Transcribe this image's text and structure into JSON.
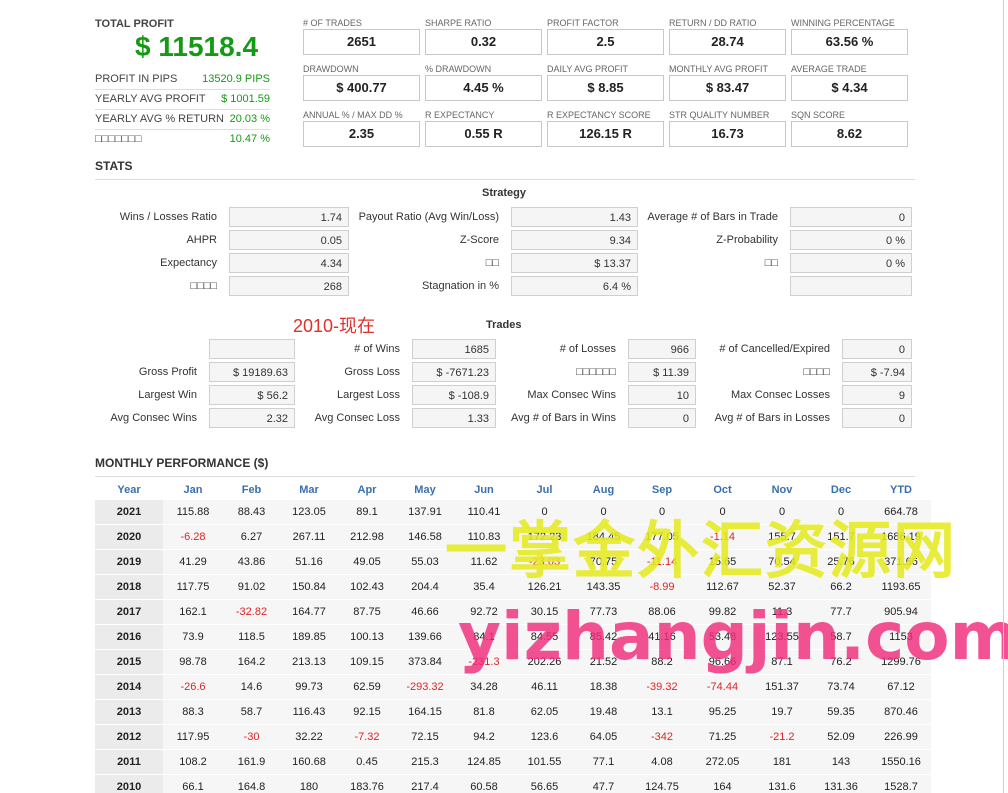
{
  "summary": {
    "total_profit_label": "TOTAL PROFIT",
    "total_profit_value": "$ 11518.4",
    "rows": [
      {
        "label": "PROFIT IN PIPS",
        "value": "13520.9 PIPS"
      },
      {
        "label": "YEARLY AVG PROFIT",
        "value": "$ 1001.59"
      },
      {
        "label": "YEARLY AVG % RETURN",
        "value": "20.03 %"
      },
      {
        "label": "□□□□□□□",
        "value": "10.47 %"
      }
    ]
  },
  "metrics": [
    {
      "label": "# OF TRADES",
      "value": "2651"
    },
    {
      "label": "SHARPE RATIO",
      "value": "0.32"
    },
    {
      "label": "PROFIT FACTOR",
      "value": "2.5"
    },
    {
      "label": "RETURN / DD RATIO",
      "value": "28.74"
    },
    {
      "label": "WINNING PERCENTAGE",
      "value": "63.56 %"
    },
    {
      "label": "DRAWDOWN",
      "value": "$ 400.77"
    },
    {
      "label": "% DRAWDOWN",
      "value": "4.45 %"
    },
    {
      "label": "DAILY AVG PROFIT",
      "value": "$ 8.85"
    },
    {
      "label": "MONTHLY AVG PROFIT",
      "value": "$ 83.47"
    },
    {
      "label": "AVERAGE TRADE",
      "value": "$ 4.34"
    },
    {
      "label": "ANNUAL % / MAX DD %",
      "value": "2.35"
    },
    {
      "label": "R EXPECTANCY",
      "value": "0.55 R"
    },
    {
      "label": "R EXPECTANCY SCORE",
      "value": "126.15 R"
    },
    {
      "label": "STR QUALITY NUMBER",
      "value": "16.73"
    },
    {
      "label": "SQN SCORE",
      "value": "8.62"
    }
  ],
  "stats": {
    "title": "STATS",
    "strategy_title": "Strategy",
    "strategy": [
      {
        "label": "Wins / Losses Ratio",
        "value": "1.74"
      },
      {
        "label": "Payout Ratio (Avg Win/Loss)",
        "value": "1.43"
      },
      {
        "label": "Average # of Bars in Trade",
        "value": "0"
      },
      {
        "label": "AHPR",
        "value": "0.05"
      },
      {
        "label": "Z-Score",
        "value": "9.34"
      },
      {
        "label": "Z-Probability",
        "value": "0 %"
      },
      {
        "label": "Expectancy",
        "value": "4.34"
      },
      {
        "label": "□□",
        "value": "$ 13.37"
      },
      {
        "label": "□□",
        "value": "0 %"
      },
      {
        "label": "□□□□",
        "value": "268"
      },
      {
        "label": "Stagnation in %",
        "value": "6.4 %"
      },
      {
        "label": "",
        "value": ""
      }
    ],
    "period_note": "2010-现在",
    "trades_title": "Trades",
    "trades": [
      {
        "label": "",
        "value": ""
      },
      {
        "label": "# of Wins",
        "value": "1685"
      },
      {
        "label": "# of Losses",
        "value": "966"
      },
      {
        "label": "# of Cancelled/Expired",
        "value": "0"
      },
      {
        "label": "Gross Profit",
        "value": "$ 19189.63"
      },
      {
        "label": "Gross Loss",
        "value": "$ -7671.23"
      },
      {
        "label": "□□□□□□",
        "value": "$ 11.39"
      },
      {
        "label": "□□□□",
        "value": "$ -7.94"
      },
      {
        "label": "Largest Win",
        "value": "$ 56.2"
      },
      {
        "label": "Largest Loss",
        "value": "$ -108.9"
      },
      {
        "label": "Max Consec Wins",
        "value": "10"
      },
      {
        "label": "Max Consec Losses",
        "value": "9"
      },
      {
        "label": "Avg Consec Wins",
        "value": "2.32"
      },
      {
        "label": "Avg Consec Loss",
        "value": "1.33"
      },
      {
        "label": "Avg # of Bars in Wins",
        "value": "0"
      },
      {
        "label": "Avg # of Bars in Losses",
        "value": "0"
      }
    ]
  },
  "monthly": {
    "title": "MONTHLY PERFORMANCE ($)",
    "headers": [
      "Year",
      "Jan",
      "Feb",
      "Mar",
      "Apr",
      "May",
      "Jun",
      "Jul",
      "Aug",
      "Sep",
      "Oct",
      "Nov",
      "Dec",
      "YTD"
    ],
    "rows": [
      [
        "2021",
        "115.88",
        "88.43",
        "123.05",
        "89.1",
        "137.91",
        "110.41",
        "0",
        "0",
        "0",
        "0",
        "0",
        "0",
        "664.78"
      ],
      [
        "2020",
        "-6.28",
        "6.27",
        "267.11",
        "212.98",
        "146.58",
        "110.83",
        "172.23",
        "184.45",
        "177.05",
        "-1.14",
        "155.7",
        "151.7",
        "1686.19"
      ],
      [
        "2019",
        "41.29",
        "43.86",
        "51.16",
        "49.05",
        "55.03",
        "11.62",
        "-23.03",
        "70.75",
        "-11.14",
        "15.65",
        "70.54",
        "25.76",
        "371.66"
      ],
      [
        "2018",
        "117.75",
        "91.02",
        "150.84",
        "102.43",
        "204.4",
        "35.4",
        "126.21",
        "143.35",
        "-8.99",
        "112.67",
        "52.37",
        "66.2",
        "1193.65"
      ],
      [
        "2017",
        "162.1",
        "-32.82",
        "164.77",
        "87.75",
        "46.66",
        "92.72",
        "30.15",
        "77.73",
        "88.06",
        "99.82",
        "11.3",
        "77.7",
        "905.94"
      ],
      [
        "2016",
        "73.9",
        "118.5",
        "189.85",
        "100.13",
        "139.66",
        "84.1",
        "84.55",
        "85.42",
        "41.16",
        "53.48",
        "123.55",
        "58.7",
        "1153"
      ],
      [
        "2015",
        "98.78",
        "164.2",
        "213.13",
        "109.15",
        "373.84",
        "-231.3",
        "202.26",
        "21.52",
        "88.2",
        "96.66",
        "87.1",
        "76.2",
        "1299.76"
      ],
      [
        "2014",
        "-26.6",
        "14.6",
        "99.73",
        "62.59",
        "-293.32",
        "34.28",
        "46.11",
        "18.38",
        "-39.32",
        "-74.44",
        "151.37",
        "73.74",
        "67.12"
      ],
      [
        "2013",
        "88.3",
        "58.7",
        "116.43",
        "92.15",
        "164.15",
        "81.8",
        "62.05",
        "19.48",
        "13.1",
        "95.25",
        "19.7",
        "59.35",
        "870.46"
      ],
      [
        "2012",
        "117.95",
        "-30",
        "32.22",
        "-7.32",
        "72.15",
        "94.2",
        "123.6",
        "64.05",
        "-342",
        "71.25",
        "-21.2",
        "52.09",
        "226.99"
      ],
      [
        "2011",
        "108.2",
        "161.9",
        "160.68",
        "0.45",
        "215.3",
        "124.85",
        "101.55",
        "77.1",
        "4.08",
        "272.05",
        "181",
        "143",
        "1550.16"
      ],
      [
        "2010",
        "66.1",
        "164.8",
        "180",
        "183.76",
        "217.4",
        "60.58",
        "56.65",
        "47.7",
        "124.75",
        "164",
        "131.6",
        "131.36",
        "1528.7"
      ]
    ]
  },
  "watermark": {
    "line1": "一掌金外汇资源网",
    "line2": "yizhangjin.com",
    "line1_color": "#e6ea20",
    "line2_color": "#f02c7c"
  },
  "colors": {
    "positive": "#159a15",
    "negative": "#e02424",
    "header": "#3a6fae"
  }
}
